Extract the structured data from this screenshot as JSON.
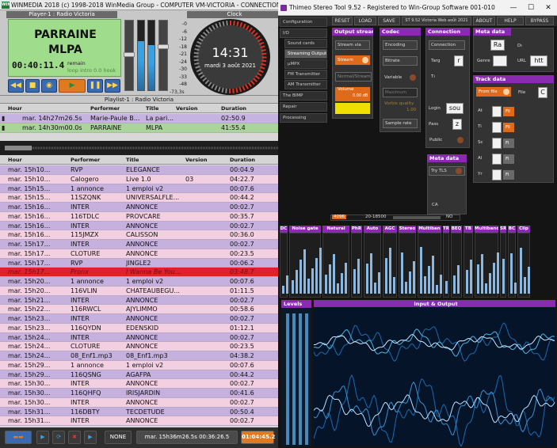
{
  "left_window": {
    "title": "WINMEDIA 2018 (c) 1998-2018 WinMedia Group - COMPUTER VM-VICTORIA - CONNECTION .\\SQLEXPR",
    "logo": "WIN",
    "player": {
      "title": "Player-1 : Radio Victoria",
      "song_title": "PARRAINE",
      "song_artist": "MLPA",
      "elapsed": "00:40:11.4",
      "remain_label": "remain",
      "intro_label": "loop intro 0.0 hook",
      "scale": [
        "-0",
        "-6",
        "-12",
        "-18",
        "-21",
        "-24",
        "-30",
        "-33",
        "-48"
      ],
      "db_readout": "-73,3s"
    },
    "clock": {
      "title": "Clock",
      "time": "14:31",
      "date": "mardi 3 août 2021"
    },
    "playlist": {
      "title": "Playlist-1 : Radio Victoria",
      "headers": [
        "Hour",
        "Performer",
        "Title",
        "Version",
        "Duration"
      ],
      "rows": [
        {
          "hour": "mar. 14h27m26.5s",
          "performer": "Marie-Paule B...",
          "title": "La pari...",
          "version": "",
          "duration": "02:50.9"
        },
        {
          "hour": "mar. 14h30m00.0s",
          "performer": "PARRAINE",
          "title": "MLPA",
          "version": "",
          "duration": "41:55.4"
        }
      ]
    },
    "history": {
      "headers": [
        "Hour",
        "Performer",
        "Title",
        "Version",
        "Duration"
      ],
      "rows": [
        {
          "hour": "mar. 15h10...",
          "performer": "RVP",
          "title": "ELEGANCE",
          "version": "",
          "duration": "00:04.9"
        },
        {
          "hour": "mar. 15h10...",
          "performer": "Calogero",
          "title": "Live 1.0",
          "version": "03",
          "duration": "04:22.7"
        },
        {
          "hour": "mar. 15h15...",
          "performer": "1 annonce",
          "title": "1 emploi v2",
          "version": "",
          "duration": "00:07.6"
        },
        {
          "hour": "mar. 15h15...",
          "performer": "11SZQNK",
          "title": "UNIVERSALFLE...",
          "version": "",
          "duration": "00:44.2"
        },
        {
          "hour": "mar. 15h16...",
          "performer": "INTER",
          "title": "ANNONCE",
          "version": "",
          "duration": "00:02.7"
        },
        {
          "hour": "mar. 15h16...",
          "performer": "116TDLC",
          "title": "PROVCARE",
          "version": "",
          "duration": "00:35.7"
        },
        {
          "hour": "mar. 15h16...",
          "performer": "INTER",
          "title": "ANNONCE",
          "version": "",
          "duration": "00:02.7"
        },
        {
          "hour": "mar. 15h16...",
          "performer": "115JMZX",
          "title": "CALISSON",
          "version": "",
          "duration": "00:36.0"
        },
        {
          "hour": "mar. 15h17...",
          "performer": "INTER",
          "title": "ANNONCE",
          "version": "",
          "duration": "00:02.7"
        },
        {
          "hour": "mar. 15h17...",
          "performer": "CLOTURE",
          "title": "ANNONCE",
          "version": "",
          "duration": "00:23.5"
        },
        {
          "hour": "mar. 15h17...",
          "performer": "RVP",
          "title": "JINGLE2",
          "version": "",
          "duration": "00:06.2"
        },
        {
          "hour": "mar. 15h17...",
          "performer": "Pronx",
          "title": "I Wanna Be You...",
          "version": "",
          "duration": "03:48.7"
        },
        {
          "hour": "mar. 15h20...",
          "performer": "1 annonce",
          "title": "1 emploi v2",
          "version": "",
          "duration": "00:07.6"
        },
        {
          "hour": "mar. 15h20...",
          "performer": "116VLIN",
          "title": "CHATEAUBEGU...",
          "version": "",
          "duration": "01:11.5"
        },
        {
          "hour": "mar. 15h21...",
          "performer": "INTER",
          "title": "ANNONCE",
          "version": "",
          "duration": "00:02.7"
        },
        {
          "hour": "mar. 15h22...",
          "performer": "116RWCL",
          "title": "AJYLIMMO",
          "version": "",
          "duration": "00:58.6"
        },
        {
          "hour": "mar. 15h23...",
          "performer": "INTER",
          "title": "ANNONCE",
          "version": "",
          "duration": "00:02.7"
        },
        {
          "hour": "mar. 15h23...",
          "performer": "116QYDN",
          "title": "EDENSKID",
          "version": "",
          "duration": "01:12.1"
        },
        {
          "hour": "mar. 15h24...",
          "performer": "INTER",
          "title": "ANNONCE",
          "version": "",
          "duration": "00:02.7"
        },
        {
          "hour": "mar. 15h24...",
          "performer": "CLOTURE",
          "title": "ANNONCE",
          "version": "",
          "duration": "00:23.5"
        },
        {
          "hour": "mar. 15h24...",
          "performer": "08_Enf1.mp3",
          "title": "08_Enf1.mp3",
          "version": "",
          "duration": "04:38.2"
        },
        {
          "hour": "mar. 15h29...",
          "performer": "1 annonce",
          "title": "1 emploi v2",
          "version": "",
          "duration": "00:07.6"
        },
        {
          "hour": "mar. 15h29...",
          "performer": "116QSNG",
          "title": "AGAFPA",
          "version": "",
          "duration": "00:44.2"
        },
        {
          "hour": "mar. 15h30...",
          "performer": "INTER",
          "title": "ANNONCE",
          "version": "",
          "duration": "00:02.7"
        },
        {
          "hour": "mar. 15h30...",
          "performer": "116QHFQ",
          "title": "IRISJARDIN",
          "version": "",
          "duration": "00:41.6"
        },
        {
          "hour": "mar. 15h30...",
          "performer": "INTER",
          "title": "ANNONCE",
          "version": "",
          "duration": "00:02.7"
        },
        {
          "hour": "mar. 15h31...",
          "performer": "116DBTY",
          "title": "TECDETUDE",
          "version": "",
          "duration": "00:50.4"
        },
        {
          "hour": "mar. 15h31...",
          "performer": "INTER",
          "title": "ANNONCE",
          "version": "",
          "duration": "00:02.7"
        }
      ]
    },
    "bottom": {
      "none_label": "NONE",
      "status": "mar. 15h36m26.5s 00:36:26.5",
      "counter": "01:04:45.2"
    }
  },
  "right_window": {
    "title": "Thimeo Stereo Tool 9.52 - Registered to Win-Group Software 001-010",
    "toolbar": [
      "RESET",
      "LOAD",
      "SAVE",
      "ST 9.52 Victoria Web août 2021",
      "ABOUT",
      "HELP",
      "BYPASS"
    ],
    "sidebar": [
      "Configuration",
      "I/O",
      "Sound cards",
      "Streaming Output",
      "µMPX",
      "FM Transmitter",
      "AM Transmitter",
      "The BIMP",
      "Repair",
      "Processing"
    ],
    "output_stream": {
      "header": "Output stream",
      "dropdown": "Stream via",
      "stream_label": "Stream",
      "normal": "Normal/Stream",
      "volume_label": "Volume",
      "volume_value": "0.00 dB"
    },
    "codec": {
      "header": "Codec",
      "encoding": "Encoding",
      "bitrate": "Bitrate",
      "variable": "Variable",
      "maximum": "Maximum",
      "quality": "Vorbis quality",
      "quality_value": "1.00",
      "sample_rate": "Sample rate"
    },
    "connection": {
      "header": "Connection",
      "dropdown": "Connection",
      "targ": "Targ",
      "targ_value": "r",
      "tl": "Tı",
      "login": "Login",
      "login_value": "sou",
      "pass": "Pass",
      "pass_value": "z",
      "public": "Public"
    },
    "meta_data": {
      "header": "Meta data",
      "ra": "Ra",
      "genre": "Genre",
      "url": "URL",
      "url_value": "htt",
      "dr": "Dı"
    },
    "meta_data2": {
      "header": "Meta data",
      "try": "Try TLS",
      "ca": "CA"
    },
    "track_data": {
      "header": "Track data",
      "from_file": "From file",
      "file_label": "File",
      "file_value": "C",
      "rows": [
        "At",
        "Ti",
        "Sc",
        "Al",
        "Yr"
      ],
      "fields": [
        "Fil",
        "Fil",
        "Fi",
        "Fi",
        "Fi"
      ]
    },
    "status_strip": [
      "4096",
      "20-18500",
      "NO"
    ],
    "modules": [
      "DC",
      "Noise gate",
      "Natural",
      "PhR",
      "Auto",
      "AGC",
      "Stereo",
      "Multiban",
      "TR",
      "BEQ",
      "TB",
      "Multiband",
      "SR",
      "BC",
      "Clip"
    ],
    "levels_label": "Levels",
    "io_label": "Input & Output"
  }
}
